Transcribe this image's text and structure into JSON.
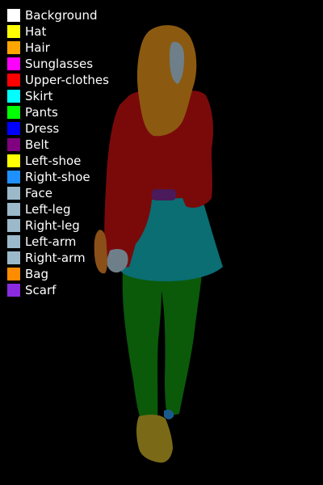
{
  "legend": [
    {
      "label": "Background",
      "color": "#ffffff"
    },
    {
      "label": "Hat",
      "color": "#ffff00"
    },
    {
      "label": "Hair",
      "color": "#ffa500"
    },
    {
      "label": "Sunglasses",
      "color": "#ff00ff"
    },
    {
      "label": "Upper-clothes",
      "color": "#ff0000"
    },
    {
      "label": "Skirt",
      "color": "#00ffff"
    },
    {
      "label": "Pants",
      "color": "#00ff00"
    },
    {
      "label": "Dress",
      "color": "#0000ff"
    },
    {
      "label": "Belt",
      "color": "#800080"
    },
    {
      "label": "Left-shoe",
      "color": "#ffff00"
    },
    {
      "label": "Right-shoe",
      "color": "#1e90ff"
    },
    {
      "label": "Face",
      "color": "#9bb9c9"
    },
    {
      "label": "Left-leg",
      "color": "#9bb9c9"
    },
    {
      "label": "Right-leg",
      "color": "#9bb9c9"
    },
    {
      "label": "Left-arm",
      "color": "#9bb9c9"
    },
    {
      "label": "Right-arm",
      "color": "#9bb9c9"
    },
    {
      "label": "Bag",
      "color": "#ff8c00"
    },
    {
      "label": "Scarf",
      "color": "#8a2be2"
    }
  ],
  "overlay_colors": {
    "background": "#000000",
    "hair": "#8b5a10",
    "face": "#6e7f8a",
    "upper_clothes": "#7a0a0a",
    "belt": "#4a1a5a",
    "skirt": "#0a6e73",
    "pants": "#0a5a0a",
    "shoes": "#7a6a18",
    "arm": "#6e7f8a",
    "bag": "#8a5018",
    "right_shoe_accent": "#1a5a8a"
  }
}
